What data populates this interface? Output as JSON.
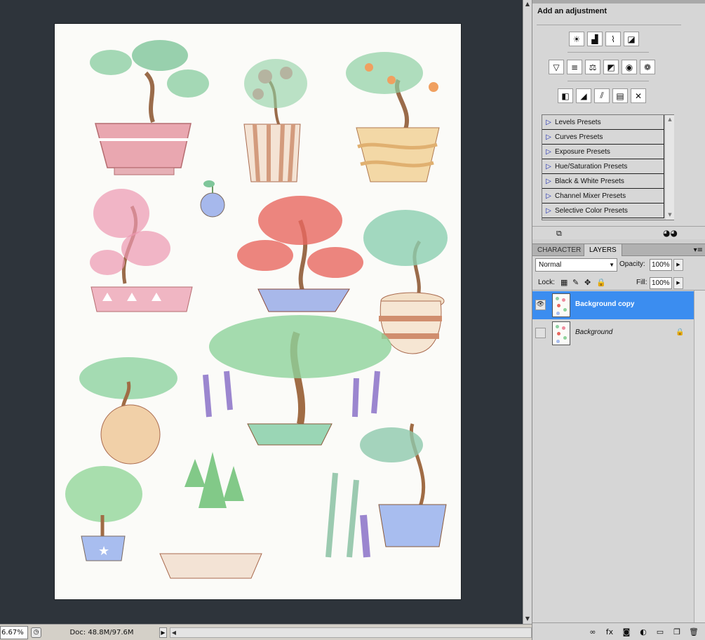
{
  "statusbar": {
    "zoom": "6.67%",
    "doc_info": "Doc: 48.8M/97.6M"
  },
  "adjustments": {
    "title": "Add an adjustment",
    "row1": [
      "brightness-contrast-icon",
      "levels-icon",
      "curves-icon",
      "exposure-icon"
    ],
    "row2": [
      "vibrance-icon",
      "hue-saturation-icon",
      "color-balance-icon",
      "black-white-icon",
      "photo-filter-icon",
      "channel-mixer-icon"
    ],
    "row3": [
      "invert-icon",
      "posterize-icon",
      "threshold-icon",
      "gradient-map-icon",
      "selective-color-icon"
    ],
    "presets": [
      "Levels Presets",
      "Curves Presets",
      "Exposure Presets",
      "Hue/Saturation Presets",
      "Black & White Presets",
      "Channel Mixer Presets",
      "Selective Color Presets"
    ]
  },
  "tabs": {
    "character": "CHARACTER",
    "layers": "LAYERS"
  },
  "layers": {
    "blend_mode": "Normal",
    "opacity_label": "Opacity:",
    "opacity": "100%",
    "lock_label": "Lock:",
    "fill_label": "Fill:",
    "fill": "100%",
    "items": [
      {
        "name": "Background copy",
        "visible": true,
        "selected": true
      },
      {
        "name": "Background",
        "visible": false,
        "selected": false
      }
    ]
  },
  "colors": {
    "canvas_bg": "#2e343b",
    "panel_bg": "#d6d6d6",
    "selection": "#3b8df0"
  }
}
